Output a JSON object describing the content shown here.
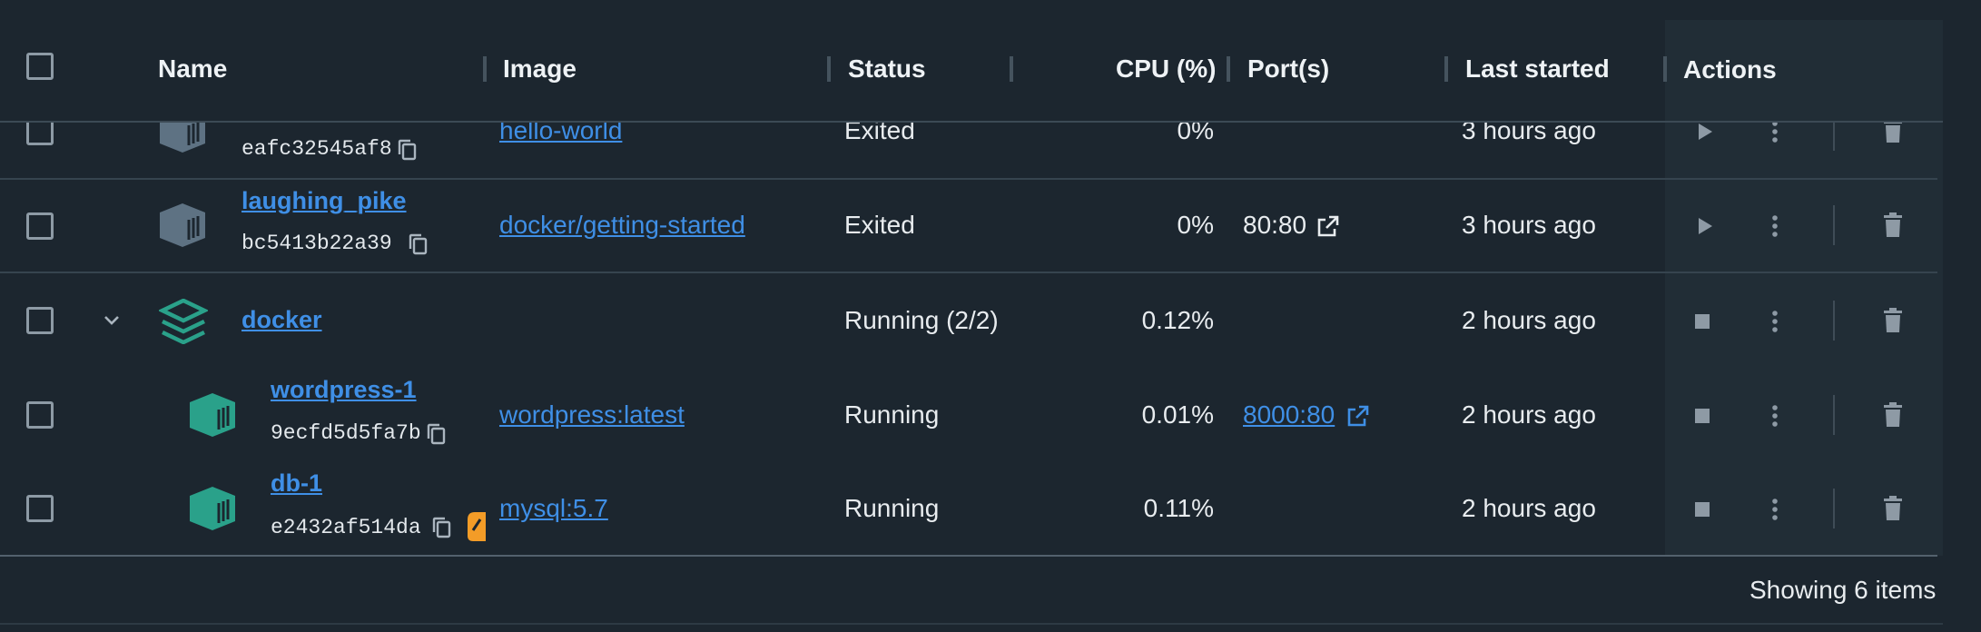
{
  "header": {
    "name": "Name",
    "image": "Image",
    "status": "Status",
    "cpu": "CPU (%)",
    "ports": "Port(s)",
    "last_started": "Last started",
    "actions": "Actions"
  },
  "rows": [
    {
      "name": "",
      "id": "eafc32545af8",
      "image": "hello-world",
      "status": "Exited",
      "cpu": "0%",
      "port": "",
      "last_started": "3 hours ago",
      "state": "stopped"
    },
    {
      "name": "laughing_pike",
      "id": "bc5413b22a39",
      "image": "docker/getting-started",
      "status": "Exited",
      "cpu": "0%",
      "port": "80:80",
      "last_started": "3 hours ago",
      "state": "stopped"
    },
    {
      "name": "docker",
      "id": "",
      "image": "",
      "status": "Running (2/2)",
      "cpu": "0.12%",
      "port": "",
      "last_started": "2 hours ago",
      "state": "running"
    },
    {
      "name": "wordpress-1",
      "id": "9ecfd5d5fa7b",
      "image": "wordpress:latest",
      "status": "Running",
      "cpu": "0.01%",
      "port": "8000:80",
      "last_started": "2 hours ago",
      "state": "running"
    },
    {
      "name": "db-1",
      "id": "e2432af514da",
      "image": "mysql:5.7",
      "status": "Running",
      "cpu": "0.11%",
      "port": "",
      "last_started": "2 hours ago",
      "state": "running"
    }
  ],
  "footer": {
    "summary": "Showing 6 items"
  },
  "colors": {
    "accent": "#3f8fe6",
    "container_running": "#2aa18a",
    "container_stopped": "#5e7283",
    "warning": "#f39c27"
  }
}
